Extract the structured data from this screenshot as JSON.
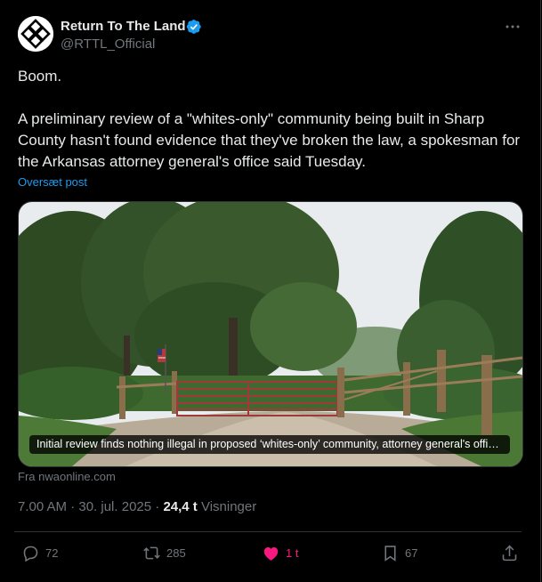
{
  "author": {
    "name": "Return To The Land",
    "handle": "@RTTL_Official",
    "verified_icon": "verified-badge-icon"
  },
  "post": {
    "line1": "Boom.",
    "body": "A preliminary review of a \"whites-only\" community being built in Sharp County hasn't found evidence that they've broken the law, a spokesman for the Arkansas attorney general's office said Tuesday.",
    "translate": "Oversæt post"
  },
  "card": {
    "caption": "Initial review finds nothing illegal in proposed ‘whites-only’ community, attorney general's office says",
    "source": "Fra nwaonline.com"
  },
  "meta": {
    "timestamp": "7.00 AM · 30. jul. 2025 · ",
    "views_count": "24,4 t",
    "views_label": " Visninger"
  },
  "actions": {
    "replies": "72",
    "reposts": "285",
    "likes": "1 t",
    "bookmarks": "67"
  },
  "colors": {
    "background": "#000000",
    "text": "#e7e9ea",
    "muted": "#71767b",
    "link": "#1d9bf0",
    "like_active": "#f91880",
    "verified": "#1d9bf0"
  }
}
